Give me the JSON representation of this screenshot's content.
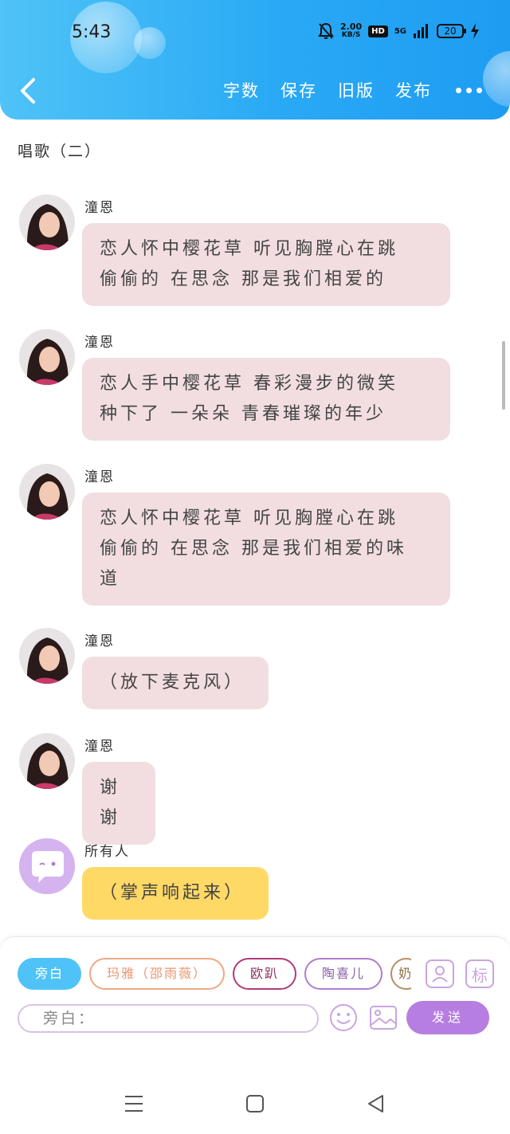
{
  "status": {
    "time": "5:43",
    "net_speed": "2.00",
    "net_unit": "KB/S",
    "hd": "HD",
    "signal": "5G",
    "battery": "20"
  },
  "header": {
    "menu": [
      "字数",
      "保存",
      "旧版",
      "发布"
    ]
  },
  "doc": {
    "title": "唱歌（二）"
  },
  "messages": [
    {
      "speaker": "潼恩",
      "lines": [
        "恋人怀中樱花草 听见胸膛心在跳",
        "偷偷的 在思念 那是我们相爱的"
      ],
      "style": "pink"
    },
    {
      "speaker": "潼恩",
      "lines": [
        "恋人手中樱花草 春彩漫步的微笑",
        "种下了 一朵朵 青春璀璨的年少"
      ],
      "style": "pink"
    },
    {
      "speaker": "潼恩",
      "lines": [
        "恋人怀中樱花草 听见胸膛心在跳",
        "偷偷的 在思念 那是我们相爱的味",
        "道"
      ],
      "style": "pink"
    },
    {
      "speaker": "潼恩",
      "lines": [
        "（放下麦克风）"
      ],
      "style": "pink"
    },
    {
      "speaker": "潼恩",
      "lines": [
        "谢谢"
      ],
      "style": "pink"
    },
    {
      "speaker": "所有人",
      "lines": [
        "（掌声响起来）"
      ],
      "style": "yellow"
    }
  ],
  "composer": {
    "chips": [
      "旁白",
      "玛雅（邵雨薇）",
      "欧趴",
      "陶喜儿",
      "奶"
    ],
    "input_placeholder": "旁白：",
    "send_label": "发送",
    "mark_label": "标"
  }
}
